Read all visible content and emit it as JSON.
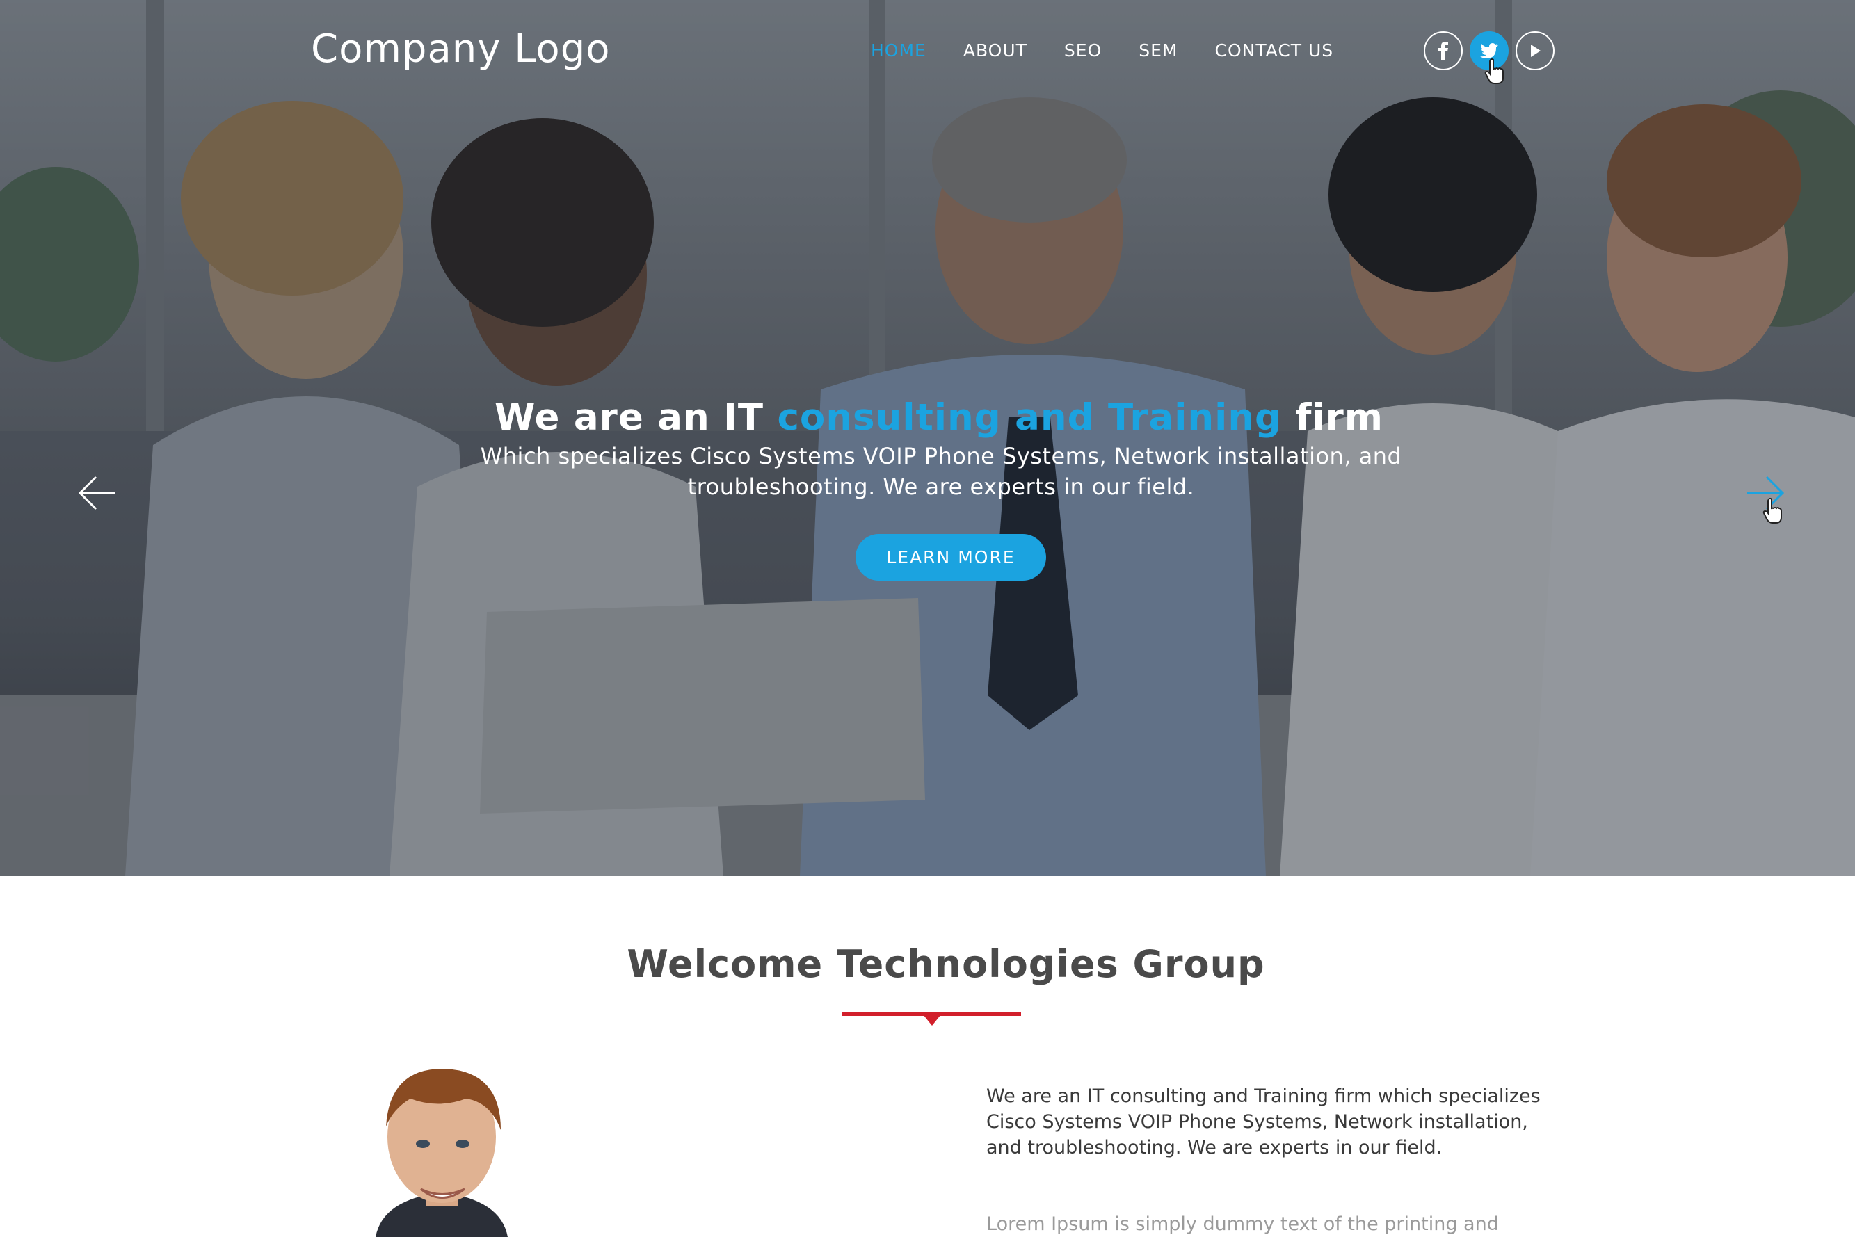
{
  "header": {
    "logo": "Company Logo",
    "nav": [
      {
        "label": "HOME",
        "active": true
      },
      {
        "label": "ABOUT",
        "active": false
      },
      {
        "label": "SEO",
        "active": false
      },
      {
        "label": "SEM",
        "active": false
      },
      {
        "label": "CONTACT US",
        "active": false
      }
    ],
    "social": [
      {
        "icon": "facebook-icon"
      },
      {
        "icon": "twitter-icon",
        "active": true
      },
      {
        "icon": "youtube-play-icon"
      }
    ]
  },
  "hero": {
    "title_pre": "We are an IT ",
    "title_accent": "consulting and Training",
    "title_post": " firm",
    "subtitle": "Which specializes Cisco Systems VOIP Phone Systems, Network installation, and troubleshooting. We are experts in our field.",
    "button_label": "LEARN MORE",
    "prev_icon": "arrow-left-icon",
    "next_icon": "arrow-right-icon"
  },
  "welcome": {
    "title": "Welcome Technologies Group",
    "paragraph": "We are an IT consulting and Training firm which specializes Cisco Systems VOIP Phone Systems, Network installation, and troubleshooting. We are experts in our field.",
    "lorem": "Lorem Ipsum is simply dummy text of the printing and"
  },
  "colors": {
    "accent": "#1ba3e0",
    "divider": "#d21f2b",
    "heading": "#4a4a4a"
  }
}
